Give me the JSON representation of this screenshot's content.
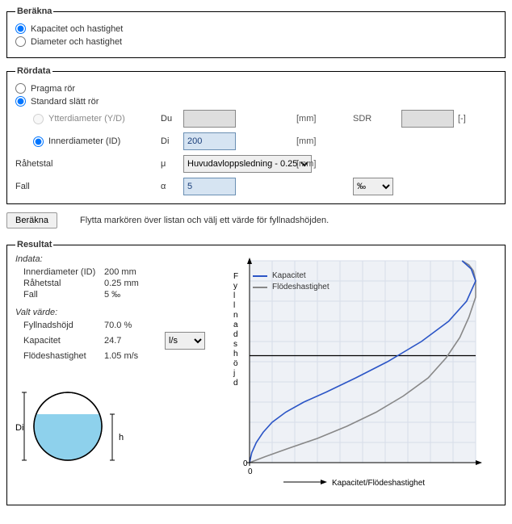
{
  "berakna": {
    "legend": "Beräkna",
    "opt_capacity": "Kapacitet och hastighet",
    "opt_diameter": "Diameter och hastighet"
  },
  "rordata": {
    "legend": "Rördata",
    "opt_pragma": "Pragma rör",
    "opt_standard": "Standard slätt rör",
    "opt_ytter": "Ytterdiameter (Y/D)",
    "opt_inner": "Innerdiameter (ID)",
    "du_label": "Du",
    "di_label": "Di",
    "du_value": "-",
    "di_value": "200",
    "mm": "[mm]",
    "sdr_label": "SDR",
    "sdr_value": "-",
    "sdr_unit": "[-]",
    "roughness_label": "Råhetstal",
    "mu": "μ",
    "roughness_select": "Huvudavloppsledning - 0.25",
    "fall_label": "Fall",
    "alpha": "α",
    "fall_value": "5",
    "permille": "‰"
  },
  "action": {
    "button": "Beräkna",
    "hint": "Flytta markören över listan och välj ett värde för fyllnadshöjden."
  },
  "resultat": {
    "legend": "Resultat",
    "indata_head": "Indata:",
    "id_label": "Innerdiameter (ID)",
    "id_value": "200 mm",
    "rough_label": "Råhetstal",
    "rough_value": "0.25 mm",
    "fall_label": "Fall",
    "fall_value": "5 ‰",
    "valt_head": "Valt värde:",
    "fyll_label": "Fyllnadshöjd",
    "fyll_value": "70.0 %",
    "kap_label": "Kapacitet",
    "kap_value": "24.7",
    "kap_unit": "l/s",
    "flow_label": "Flödeshastighet",
    "flow_value": "1.05 m/s",
    "di_sym": "Di",
    "h_sym": "h"
  },
  "chart": {
    "y_label": "Fyllnadshöjd",
    "x_label": "Kapacitet/Flödeshastighet",
    "zero": "0",
    "legend_kap": "Kapacitet",
    "legend_flow": "Flödeshastighet",
    "colors": {
      "kap": "#2b55c6",
      "flow": "#888888",
      "grid": "#d7dde8",
      "bg": "#eef1f6"
    }
  },
  "chart_data": {
    "type": "line",
    "title": "",
    "xlabel": "Kapacitet/Flödeshastighet",
    "ylabel": "Fyllnadshöjd",
    "xlim": [
      0,
      1
    ],
    "ylim": [
      0,
      1
    ],
    "series": [
      {
        "name": "Kapacitet",
        "color": "#2b55c6",
        "x": [
          0.0,
          0.01,
          0.03,
          0.06,
          0.1,
          0.16,
          0.24,
          0.34,
          0.47,
          0.61,
          0.76,
          0.88,
          0.96,
          1.0,
          0.98,
          0.94
        ],
        "y": [
          0.0,
          0.05,
          0.1,
          0.15,
          0.2,
          0.25,
          0.3,
          0.35,
          0.42,
          0.5,
          0.6,
          0.7,
          0.8,
          0.9,
          0.96,
          1.0
        ]
      },
      {
        "name": "Flödeshastighet",
        "color": "#888888",
        "x": [
          0.0,
          0.07,
          0.17,
          0.3,
          0.43,
          0.56,
          0.68,
          0.79,
          0.87,
          0.93,
          0.97,
          1.0,
          1.0,
          0.99,
          0.97,
          0.94
        ],
        "y": [
          0.0,
          0.03,
          0.07,
          0.12,
          0.18,
          0.25,
          0.33,
          0.42,
          0.52,
          0.62,
          0.72,
          0.82,
          0.9,
          0.95,
          0.98,
          1.0
        ]
      }
    ],
    "selected_fill_fraction": 0.53
  }
}
